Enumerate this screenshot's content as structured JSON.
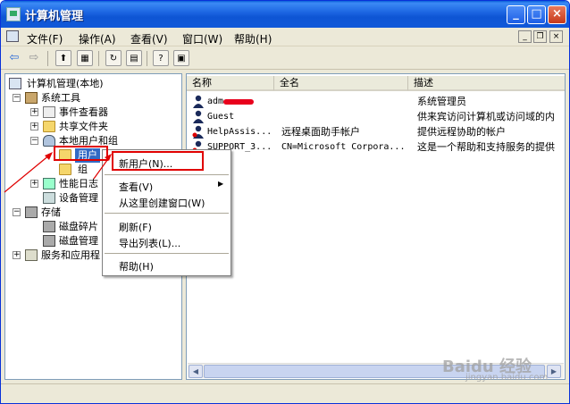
{
  "window": {
    "title": "计算机管理",
    "min_label": "_",
    "max_label": "□",
    "close_label": "×"
  },
  "menu": {
    "file": "文件(F)",
    "action": "操作(A)",
    "view": "查看(V)",
    "window": "窗口(W)",
    "help": "帮助(H)",
    "mdi_min": "_",
    "mdi_restore": "❐",
    "mdi_close": "×"
  },
  "tree": {
    "root": "计算机管理(本地)",
    "system_tools": "系统工具",
    "event_viewer": "事件查看器",
    "shared_folders": "共享文件夹",
    "local_users": "本地用户和组",
    "users": "用户",
    "groups": "组",
    "perf_logs": "性能日志",
    "device_manager": "设备管理",
    "storage": "存储",
    "disk_defrag": "磁盘碎片",
    "disk_mgmt": "磁盘管理",
    "services": "服务和应用程"
  },
  "list": {
    "columns": [
      "名称",
      "全名",
      "描述"
    ],
    "rows": [
      {
        "name": "adm",
        "fullname": "",
        "desc": "系统管理员"
      },
      {
        "name": "Guest",
        "fullname": "",
        "desc": "供来宾访问计算机或访问域的内"
      },
      {
        "name": "HelpAssis...",
        "fullname": "远程桌面助手帐户",
        "desc": "提供远程协助的帐户"
      },
      {
        "name": "SUPPORT_3...",
        "fullname": "CN=Microsoft Corpora...",
        "desc": "这是一个帮助和支持服务的提供"
      }
    ]
  },
  "context_menu": {
    "new_user": "新用户(N)...",
    "view": "查看(V)",
    "new_window": "从这里创建窗口(W)",
    "refresh": "刷新(F)",
    "export": "导出列表(L)...",
    "help": "帮助(H)"
  },
  "watermark": {
    "main": "Baidu 经验",
    "sub": "jingyan.baidu.com"
  },
  "colors": {
    "titlebar": "#0e55d4",
    "highlight_box": "#e00000",
    "selection": "#316ac5"
  }
}
